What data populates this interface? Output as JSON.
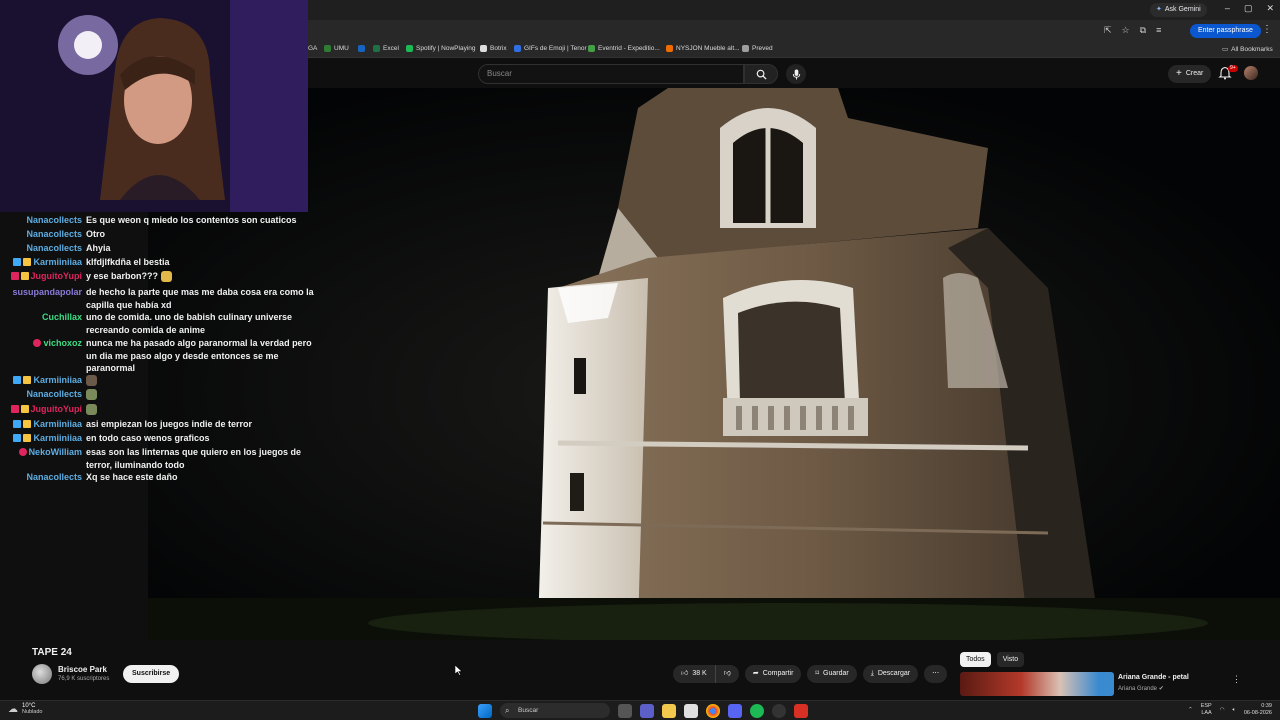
{
  "browser": {
    "gemini_label": "Ask Gemini",
    "passphrase_label": "Enter passphrase",
    "bookmarks": [
      {
        "label": "GA",
        "color": "#888888"
      },
      {
        "label": "UMU",
        "color": "#2e7d32"
      },
      {
        "label": "",
        "color": "#1565c0"
      },
      {
        "label": "Excel",
        "color": "#1e7145"
      },
      {
        "label": "Spotify | NowPlaying",
        "color": "#1db954"
      },
      {
        "label": "Botrix",
        "color": "#dddddd"
      },
      {
        "label": "GIFs de Emoji | Tenor",
        "color": "#2f6fdf"
      },
      {
        "label": "Eventrid - Expeditio...",
        "color": "#43a047"
      },
      {
        "label": "NYSJON Mueble alt...",
        "color": "#ef6c00"
      },
      {
        "label": "Preved",
        "color": "#9e9e9e"
      }
    ],
    "all_bookmarks_label": "All Bookmarks"
  },
  "youtube": {
    "search_placeholder": "Buscar",
    "create_label": "Crear",
    "notification_count": "9+"
  },
  "chat": [
    {
      "user": "Nanacollects",
      "color": "#5dade2",
      "badges": [],
      "text": "Es que weon q miedo los contentos son cuaticos"
    },
    {
      "user": "Nanacollects",
      "color": "#5dade2",
      "badges": [],
      "text": "Otro"
    },
    {
      "user": "Nanacollects",
      "color": "#5dade2",
      "badges": [],
      "text": "Ahyia"
    },
    {
      "user": "Karmiiniiaa",
      "color": "#5dade2",
      "badges": [
        "#3fa9f5",
        "#f5c542"
      ],
      "text": "klfdjlfkdña el bestia"
    },
    {
      "user": "JuguitoYupi",
      "color": "#e0245e",
      "badges": [
        "#e0245e",
        "#f5c542"
      ],
      "text": "y ese barbon???"
    },
    {
      "user": "susupandapolar",
      "color": "#8a7bd8",
      "badges": [],
      "text": "de hecho la parte que mas me daba cosa era como la capilla que había xd"
    },
    {
      "user": "Cuchillax",
      "color": "#3ddc84",
      "badges": [],
      "text": "uno de comida. uno de babish culinary universe recreando comida de anime"
    },
    {
      "user": "vichoxoz",
      "color": "#3ddc84",
      "badges": [
        "#e0245e"
      ],
      "text": "nunca me ha pasado algo paranormal la verdad pero un dia me paso algo y desde entonces se me paranormal"
    },
    {
      "user": "Karmiiniiaa",
      "color": "#5dade2",
      "badges": [
        "#3fa9f5",
        "#f5c542"
      ],
      "text": ""
    },
    {
      "user": "Nanacollects",
      "color": "#5dade2",
      "badges": [],
      "text": ""
    },
    {
      "user": "JuguitoYupi",
      "color": "#e0245e",
      "badges": [
        "#e0245e",
        "#f5c542"
      ],
      "text": ""
    },
    {
      "user": "Karmiiniiaa",
      "color": "#5dade2",
      "badges": [
        "#3fa9f5",
        "#f5c542"
      ],
      "text": "asi empiezan los juegos indie de terror"
    },
    {
      "user": "Karmiiniiaa",
      "color": "#5dade2",
      "badges": [
        "#3fa9f5",
        "#f5c542"
      ],
      "text": "en todo caso wenos graficos"
    },
    {
      "user": "NekoWilliam",
      "color": "#5dade2",
      "badges": [
        "#e0245e"
      ],
      "text": "esas son las linternas que quiero en los juegos de terror, iluminando todo"
    },
    {
      "user": "Nanacollects",
      "color": "#5dade2",
      "badges": [],
      "text": "Xq se hace este daño"
    }
  ],
  "video": {
    "title": "TAPE 24",
    "channel": "Briscoe Park",
    "subscribers": "76,9 K suscriptores",
    "subscribe_label": "Suscribirse",
    "likes": "38 K",
    "share_label": "Compartir",
    "save_label": "Guardar",
    "download_label": "Descargar"
  },
  "related": {
    "chips": [
      "Todos",
      "Visto"
    ],
    "title": "Ariana Grande - petal",
    "channel": "Ariana Grande"
  },
  "taskbar": {
    "temperature": "10°C",
    "weather": "Nublado",
    "search_label": "Buscar",
    "lang1": "ESP",
    "lang2": "LAA",
    "time": "0:39",
    "date": "06-08-2026"
  }
}
